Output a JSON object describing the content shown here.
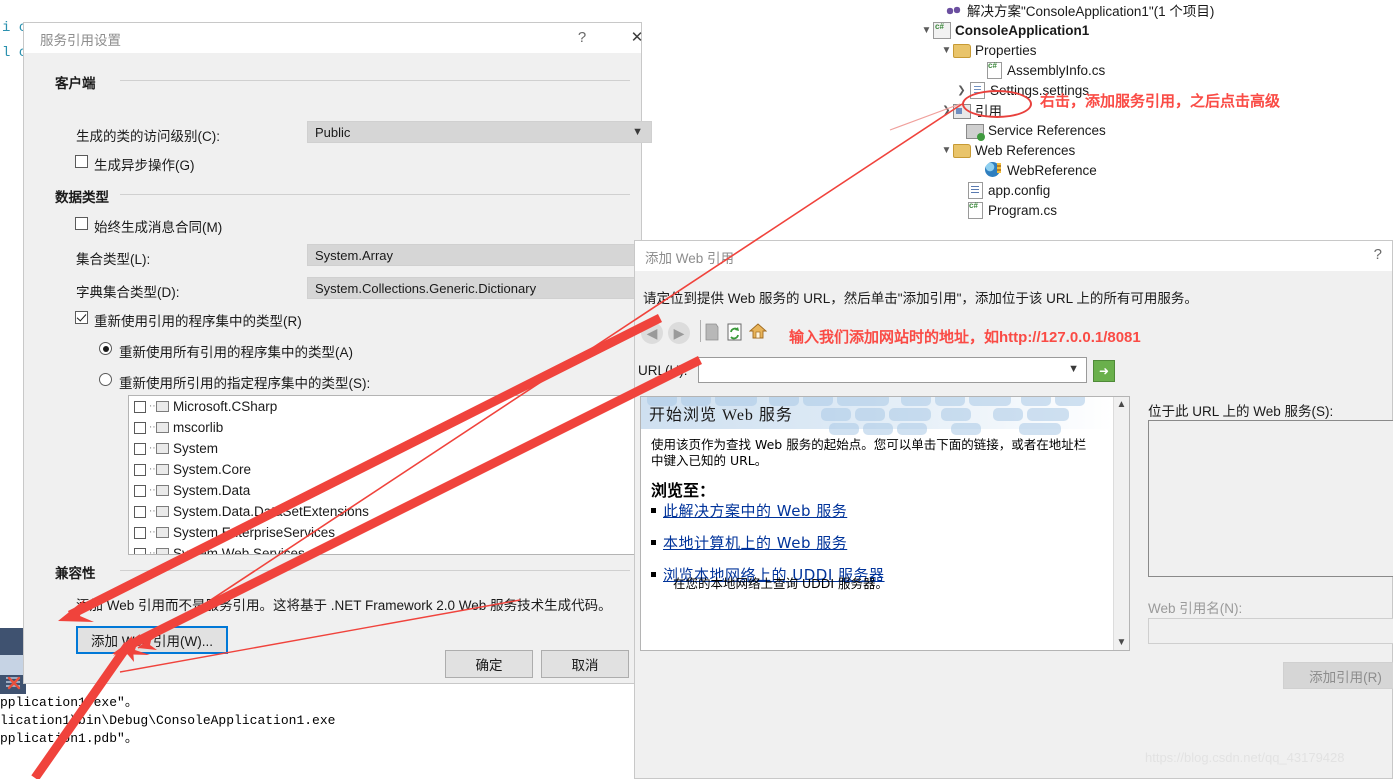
{
  "solution_explorer": {
    "tree": [
      {
        "label": "解决方案\"ConsoleApplication1\"(1 个项目)",
        "icon": "solution-icon",
        "indent": 0,
        "chevron": "",
        "bold": false
      },
      {
        "label": "ConsoleApplication1",
        "icon": "csharp-project-icon",
        "indent": 1,
        "chevron": "v",
        "bold": true
      },
      {
        "label": "Properties",
        "icon": "folder-icon",
        "indent": 2,
        "chevron": "v",
        "bold": false
      },
      {
        "label": "AssemblyInfo.cs",
        "icon": "csharp-file-icon",
        "indent": 3,
        "chevron": "",
        "bold": false
      },
      {
        "label": "Settings.settings",
        "icon": "settings-file-icon",
        "indent": 3,
        "chevron": ">",
        "bold": false
      },
      {
        "label": "引用",
        "icon": "references-icon",
        "indent": 2,
        "chevron": ">",
        "bold": false
      },
      {
        "label": "Service References",
        "icon": "service-references-icon",
        "indent": 2,
        "chevron": "",
        "bold": false
      },
      {
        "label": "Web References",
        "icon": "folder-icon",
        "indent": 2,
        "chevron": "v",
        "bold": false
      },
      {
        "label": "WebReference",
        "icon": "globe-icon",
        "indent": 3,
        "chevron": "",
        "bold": false
      },
      {
        "label": "app.config",
        "icon": "config-file-icon",
        "indent": 2,
        "chevron": "",
        "bold": false
      },
      {
        "label": "Program.cs",
        "icon": "csharp-file-icon",
        "indent": 2,
        "chevron": "",
        "bold": false
      }
    ]
  },
  "annotations": {
    "tree_note": "右击，添加服务引用，之后点击高级",
    "url_note": "输入我们添加网站时的地址，如http://127.0.0.1/8081",
    "color": "#fa4b45"
  },
  "service_ref_dialog": {
    "title": "服务引用设置",
    "help_glyph": "?",
    "close_glyph": "✕",
    "groups": {
      "client": "客户端",
      "data_type": "数据类型",
      "compatibility": "兼容性"
    },
    "access_level_label": "生成的类的访问级别(C):",
    "access_level_value": "Public",
    "async_checkbox_label": "生成异步操作(G)",
    "async_checked": false,
    "always_message_contract_label": "始终生成消息合同(M)",
    "always_message_contract_checked": false,
    "collection_type_label": "集合类型(L):",
    "collection_type_value": "System.Array",
    "dict_collection_type_label": "字典集合类型(D):",
    "dict_collection_type_value": "System.Collections.Generic.Dictionary",
    "reuse_types_label": "重新使用引用的程序集中的类型(R)",
    "reuse_types_checked": true,
    "reuse_all_label": "重新使用所有引用的程序集中的类型(A)",
    "reuse_all_selected": true,
    "reuse_specified_label": "重新使用所引用的指定程序集中的类型(S):",
    "reuse_specified_selected": false,
    "assemblies": [
      "Microsoft.CSharp",
      "mscorlib",
      "System",
      "System.Core",
      "System.Data",
      "System.Data.DataSetExtensions",
      "System.EnterpriseServices",
      "System.Web.Services"
    ],
    "compat_text": "添加 Web 引用而不是服务引用。这将基于 .NET Framework 2.0 Web 服务技术生成代码。",
    "add_web_ref_button": "添加 Web 引用(W)...",
    "ok_button": "确定",
    "cancel_button": "取消"
  },
  "add_web_ref_dialog": {
    "title": "添加 Web 引用",
    "help_glyph": "?",
    "instruction": "请定位到提供 Web 服务的 URL，然后单击\"添加引用\"，添加位于该 URL 上的所有可用服务。",
    "toolbar": {
      "back": "back-arrow",
      "forward": "forward-arrow",
      "stop": "stop-icon",
      "refresh": "refresh-icon",
      "home": "home-icon"
    },
    "url_label": "URL(U):",
    "url_value": "",
    "go_glyph": "➜",
    "browser": {
      "banner_title": "开始浏览 Web 服务",
      "paragraph": "使用该页作为查找 Web 服务的起始点。您可以单击下面的链接，或者在地址栏中键入已知的 URL。",
      "heading": "浏览至：",
      "links": [
        "此解决方案中的 Web 服务",
        "本地计算机上的 Web 服务",
        "浏览本地网络上的 UDDI 服务器"
      ],
      "sub_text": "在您的本地网络上查询 UDDI 服务器。"
    },
    "services_label": "位于此 URL 上的 Web 服务(S):",
    "ref_name_label": "Web 引用名(N):",
    "ref_name_value": "",
    "add_ref_button": "添加引用(R)"
  },
  "output_pane": {
    "lines": [
      "pplication1.exe\"。",
      "lication1\\bin\\Debug\\ConsoleApplication1.exe",
      "pplication1.pdb\"。"
    ]
  },
  "code_remnant": {
    "lines": [
      "i c",
      "l c"
    ]
  },
  "watermark": "https://blog.csdn.net/qq_43179428"
}
